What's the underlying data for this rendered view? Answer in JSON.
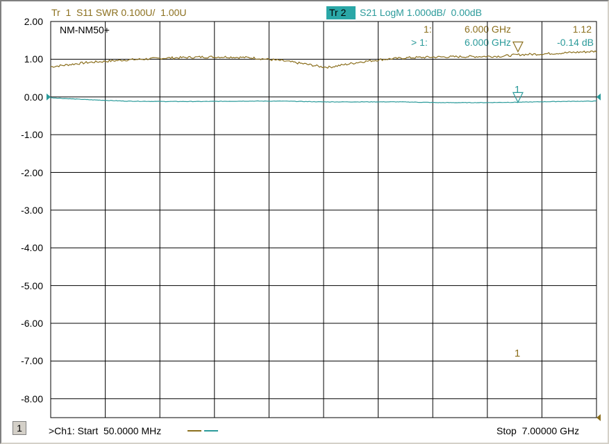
{
  "chart_data": {
    "type": "line",
    "title": "",
    "xlabel": "",
    "ylabel": "",
    "xlim": [
      0.05,
      7.0
    ],
    "ylim": [
      -8.5,
      2.0
    ],
    "yticks": [
      "2.00",
      "1.00",
      "0.00",
      "-1.00",
      "-2.00",
      "-3.00",
      "-4.00",
      "-5.00",
      "-6.00",
      "-7.00",
      "-8.00"
    ],
    "grid": true,
    "legend": "none",
    "series": [
      {
        "name": "S11 SWR",
        "color": "#8b6f1d",
        "scale": "grid 0.00 = 1.00 U, 0.100 U per division",
        "x": [
          0.05,
          0.5,
          1.0,
          1.5,
          2.0,
          2.3,
          2.6,
          3.0,
          3.3,
          3.5,
          3.6,
          3.8,
          4.0,
          4.3,
          4.6,
          5.0,
          5.4,
          5.8,
          6.0,
          6.3,
          6.6,
          7.0
        ],
        "values": [
          1.08,
          1.091,
          1.098,
          1.103,
          1.106,
          1.106,
          1.104,
          1.096,
          1.087,
          1.08,
          1.079,
          1.086,
          1.093,
          1.1,
          1.104,
          1.106,
          1.107,
          1.108,
          1.112,
          1.114,
          1.117,
          1.121
        ]
      },
      {
        "name": "S21 LogM",
        "color": "#2a9a9a",
        "scale": "grid 0.00 = 0.00 dB, 1.000 dB per division",
        "x": [
          0.05,
          0.5,
          1.0,
          1.5,
          2.0,
          2.5,
          3.0,
          3.5,
          4.0,
          4.5,
          5.0,
          5.5,
          6.0,
          6.5,
          7.0
        ],
        "values": [
          -0.02,
          -0.07,
          -0.11,
          -0.12,
          -0.12,
          -0.11,
          -0.11,
          -0.13,
          -0.13,
          -0.13,
          -0.15,
          -0.15,
          -0.14,
          -0.12,
          -0.11
        ]
      }
    ],
    "markers": [
      {
        "label": "1",
        "trace": 1,
        "x": 6.0,
        "y": 1.12
      },
      {
        "label": "1",
        "trace": 2,
        "x": 6.0,
        "y": -0.14
      }
    ]
  },
  "header": {
    "tr1_label": "Tr  1  S11 SWR 0.100U/  1.00U",
    "tr2_tag": "Tr  2",
    "tr2_label": "S21 LogM 1.000dB/  0.00dB"
  },
  "marker_readout": {
    "row1_id": "1:",
    "row1_freq": "6.000 GHz",
    "row1_value": "1.12",
    "row2_id": "> 1:",
    "row2_freq": "6.000 GHz",
    "row2_value": "-0.14 dB"
  },
  "annotation": "NM-NM50+",
  "marker_labels": {
    "tr1": "1",
    "tr2": "1"
  },
  "footer": {
    "channel_box": "1",
    "start": ">Ch1: Start  50.0000 MHz",
    "stop": "Stop  7.00000 GHz"
  },
  "colors": {
    "trace1": "#8b6f1d",
    "trace2": "#2a9a9a",
    "grid": "#000000"
  }
}
